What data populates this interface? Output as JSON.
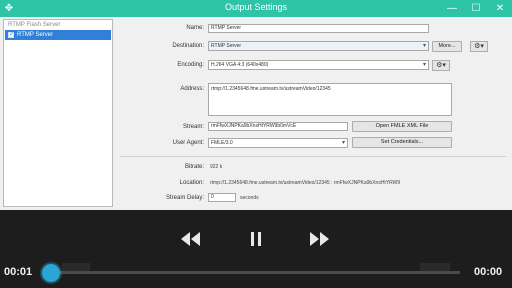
{
  "window": {
    "title": "Output Settings",
    "move_glyph": "✥",
    "minimize_glyph": "—",
    "maximize_glyph": "☐",
    "close_glyph": "✕"
  },
  "sidebar": {
    "header": "RTMP Flash Server",
    "items": [
      {
        "label": "RTMP Server",
        "checked": true,
        "check_glyph": "✓"
      }
    ]
  },
  "form": {
    "name_label": "Name:",
    "name_value": "RTMP Server",
    "destination_label": "Destination:",
    "destination_value": "RTMP Server",
    "more_button": "More...",
    "encoding_label": "Encoding:",
    "encoding_value": "H.264 VGA 4:3 (640x480)",
    "address_label": "Address:",
    "address_value": "rtmp://1.2345648.fme.ustream.tv/ustreamVideo/12345",
    "stream_label": "Stream:",
    "stream_value": "rmFfwXJNPKa9bXnsHtYRW9b0mVcE",
    "open_xml_button": "Open FMLE XML File",
    "user_agent_label": "User Agent:",
    "user_agent_value": "FMLE/3.0",
    "set_credentials_button": "Set Credentials...",
    "bitrate_label": "Bitrate:",
    "bitrate_value": "922 k",
    "location_label": "Location:",
    "location_value": "rtmp://1.2345648.fme.ustream.tv/ustreamVideo/12345 : rmFfwXJNPKa9bXnsHtYRW9",
    "stream_delay_label": "Stream Delay:",
    "stream_delay_value": "0",
    "stream_delay_unit": "seconds",
    "gear_glyph": "⚙▾"
  },
  "player": {
    "current_time": "00:01",
    "total_time": "00:00",
    "progress": 0.03,
    "rewind_icon": "rewind-icon",
    "pause_icon": "pause-icon",
    "forward_icon": "fast-forward-icon",
    "accent_color": "#2aa6d6"
  }
}
